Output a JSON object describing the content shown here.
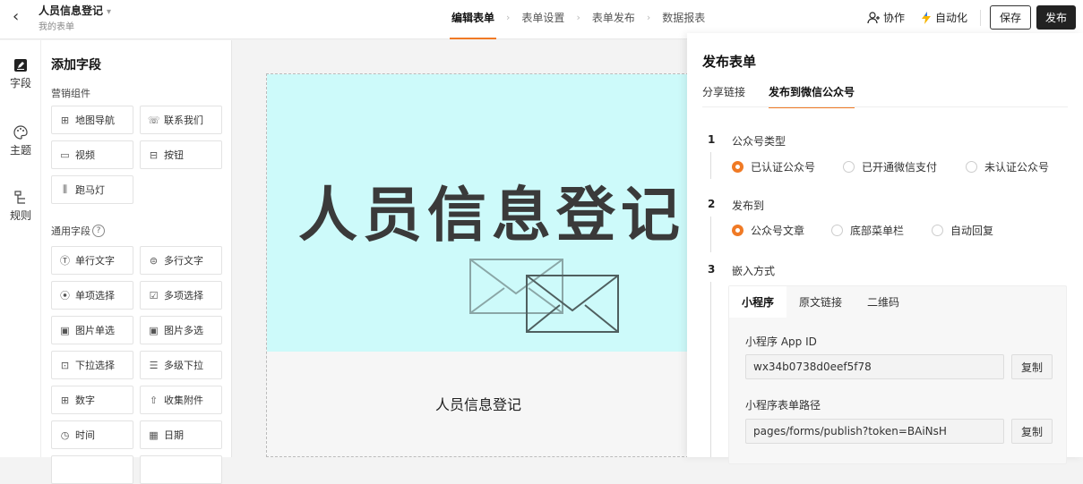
{
  "header": {
    "title": "人员信息登记",
    "subtitle": "我的表单",
    "steps": [
      "编辑表单",
      "表单设置",
      "表单发布",
      "数据报表"
    ],
    "collab_label": "协作",
    "auto_label": "自动化",
    "save_label": "保存",
    "publish_label": "发布",
    "accent_color": "#f07a25"
  },
  "rail": {
    "items": [
      {
        "label": "字段",
        "icon": "edit-icon"
      },
      {
        "label": "主题",
        "icon": "palette-icon"
      },
      {
        "label": "规则",
        "icon": "rules-icon"
      }
    ]
  },
  "fields": {
    "heading": "添加字段",
    "marketing_section": "营销组件",
    "marketing_items": [
      "地图导航",
      "联系我们",
      "视频",
      "按钮",
      "跑马灯"
    ],
    "common_section": "通用字段",
    "common_items": [
      "单行文字",
      "多行文字",
      "单项选择",
      "多项选择",
      "图片单选",
      "图片多选",
      "下拉选择",
      "多级下拉",
      "数字",
      "收集附件",
      "时间",
      "日期"
    ]
  },
  "canvas": {
    "banner_title": "人员信息登记",
    "form_name": "人员信息登记",
    "banner_color": "#cdfafa"
  },
  "publish_panel": {
    "title": "发布表单",
    "tabs": [
      "分享链接",
      "发布到微信公众号"
    ],
    "q1_num": "1",
    "q1_label": "公众号类型",
    "q1_options": [
      "已认证公众号",
      "已开通微信支付",
      "未认证公众号"
    ],
    "q2_num": "2",
    "q2_label": "发布到",
    "q2_options": [
      "公众号文章",
      "底部菜单栏",
      "自动回复"
    ],
    "q3_num": "3",
    "q3_label": "嵌入方式",
    "embed_tabs": [
      "小程序",
      "原文链接",
      "二维码"
    ],
    "appid_label": "小程序 App ID",
    "appid_value": "wx34b0738d0eef5f78",
    "path_label": "小程序表单路径",
    "path_value": "pages/forms/publish?token=BAiNsH",
    "copy_label": "复制"
  }
}
